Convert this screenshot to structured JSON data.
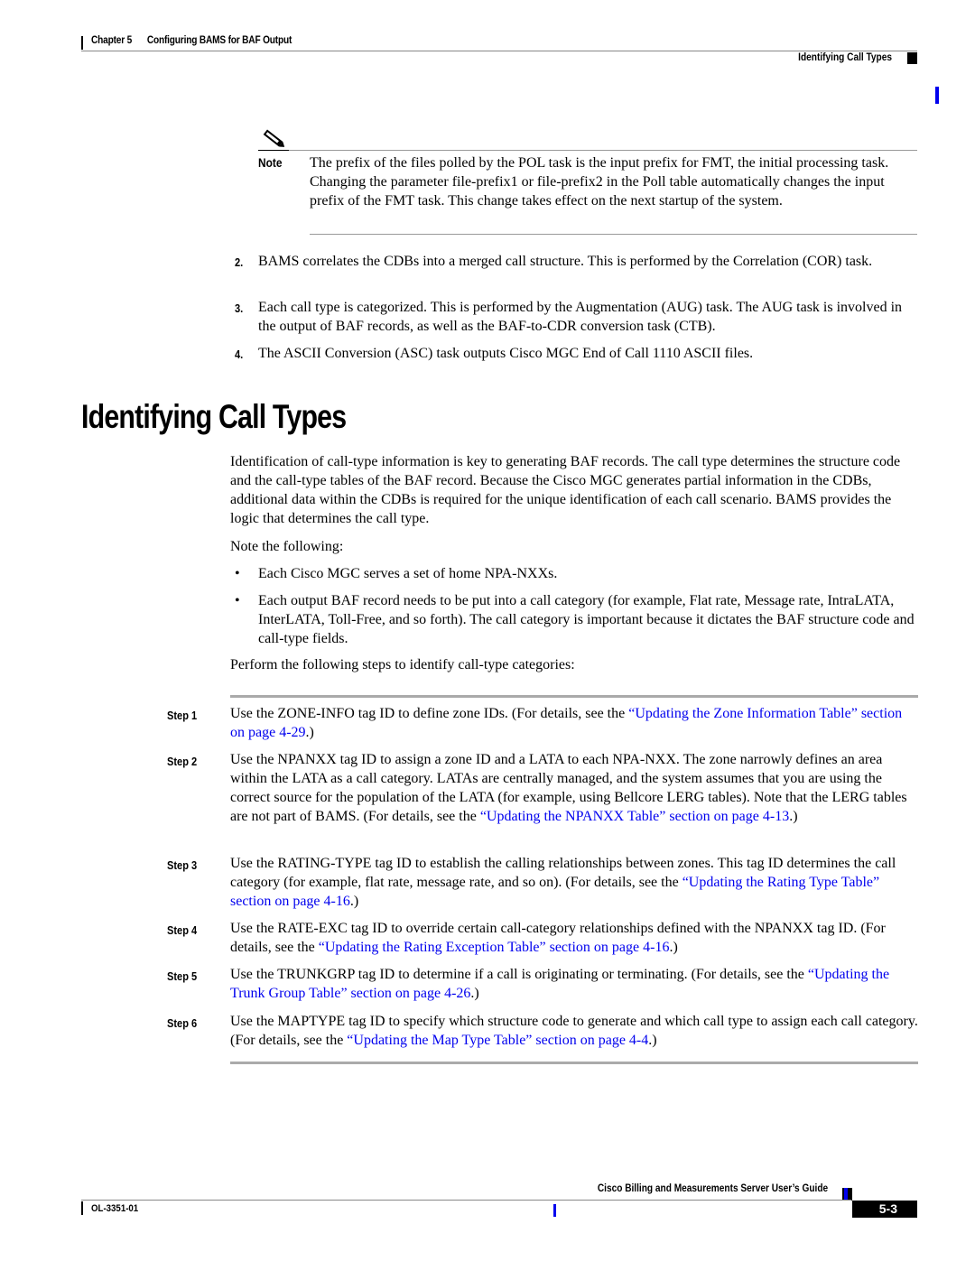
{
  "header": {
    "chapter_num": "Chapter 5",
    "chapter_title": "Configuring BAMS for BAF Output",
    "section_title": "Identifying Call Types"
  },
  "note": {
    "icon": "pencil-note-icon",
    "label": "Note",
    "text": "The prefix of the files polled by the POL task is the input prefix for FMT, the initial processing task. Changing the parameter file-prefix1 or file-prefix2 in the Poll table automatically changes the input prefix of the FMT task. This change takes effect on the next startup of the system."
  },
  "numbered_list": [
    {
      "num": "2.",
      "text": "BAMS correlates the CDBs into a merged call structure. This is performed by the Correlation (COR) task."
    },
    {
      "num": "3.",
      "text": "Each call type is categorized. This is performed by the Augmentation (AUG) task. The AUG task is involved in the output of BAF records, as well as the BAF-to-CDR conversion task (CTB)."
    },
    {
      "num": "4.",
      "text": "The ASCII Conversion (ASC) task outputs Cisco MGC End of Call 1110 ASCII files."
    }
  ],
  "heading": "Identifying Call Types",
  "intro": "Identification of call-type information is key to generating BAF records. The call type determines the structure code and the call-type tables of the BAF record. Because the Cisco MGC generates partial information in the CDBs, additional data within the CDBs is required for the unique identification of each call scenario. BAMS provides the logic that determines the call type.",
  "note_following": "Note the following:",
  "bullets": [
    {
      "dot": "•",
      "text": "Each Cisco MGC serves a set of home NPA-NXXs."
    },
    {
      "dot": "•",
      "text": "Each output BAF record needs to be put into a call category (for example, Flat rate, Message rate, IntraLATA, InterLATA, Toll-Free, and so forth). The call category is important because it dictates the BAF structure code and call-type fields."
    }
  ],
  "perform_intro": "Perform the following steps to identify call-type categories:",
  "steps": [
    {
      "label": "Step 1",
      "before": "Use the ZONE-INFO tag ID to define zone IDs. (For details, see the ",
      "link": "“Updating the Zone Information Table” section on page 4-29",
      "after": ".)"
    },
    {
      "label": "Step 2",
      "before": "Use the NPANXX tag ID to assign a zone ID and a LATA to each NPA-NXX. The zone narrowly defines an area within the LATA as a call category. LATAs are centrally managed, and the system assumes that you are using the correct source for the population of the LATA (for example, using Bellcore LERG tables). Note that the LERG tables are not part of BAMS. (For details, see the ",
      "link": "“Updating the NPANXX Table” section on page 4-13",
      "after": ".)"
    },
    {
      "label": "Step 3",
      "before": "Use the RATING-TYPE tag ID to establish the calling relationships between zones. This tag ID determines the call category (for example, flat rate, message rate, and so on). (For details, see the ",
      "link": "“Updating the Rating Type Table” section on page 4-16",
      "after": ".)"
    },
    {
      "label": "Step 4",
      "before": "Use the RATE-EXC tag ID to override certain call-category relationships defined with the NPANXX tag ID. (For details, see the ",
      "link": "“Updating the Rating Exception Table” section on page 4-16",
      "after": ".)"
    },
    {
      "label": "Step 5",
      "before": "Use the TRUNKGRP tag ID to determine if a call is originating or terminating. (For details, see the ",
      "link": "“Updating the Trunk Group Table” section on page 4-26",
      "after": ".)"
    },
    {
      "label": "Step 6",
      "before": "Use the MAPTYPE tag ID to specify which structure code to generate and which call type to assign each call category. (For details, see the ",
      "link": "“Updating the Map Type Table” section on page 4-4",
      "after": ".)"
    }
  ],
  "footer": {
    "guide_title": "Cisco Billing and Measurements Server User’s Guide",
    "doc_number": "OL-3351-01",
    "page_number": "5-3"
  },
  "colors": {
    "link": "#0000ee",
    "change_bar": "#0000ee"
  }
}
